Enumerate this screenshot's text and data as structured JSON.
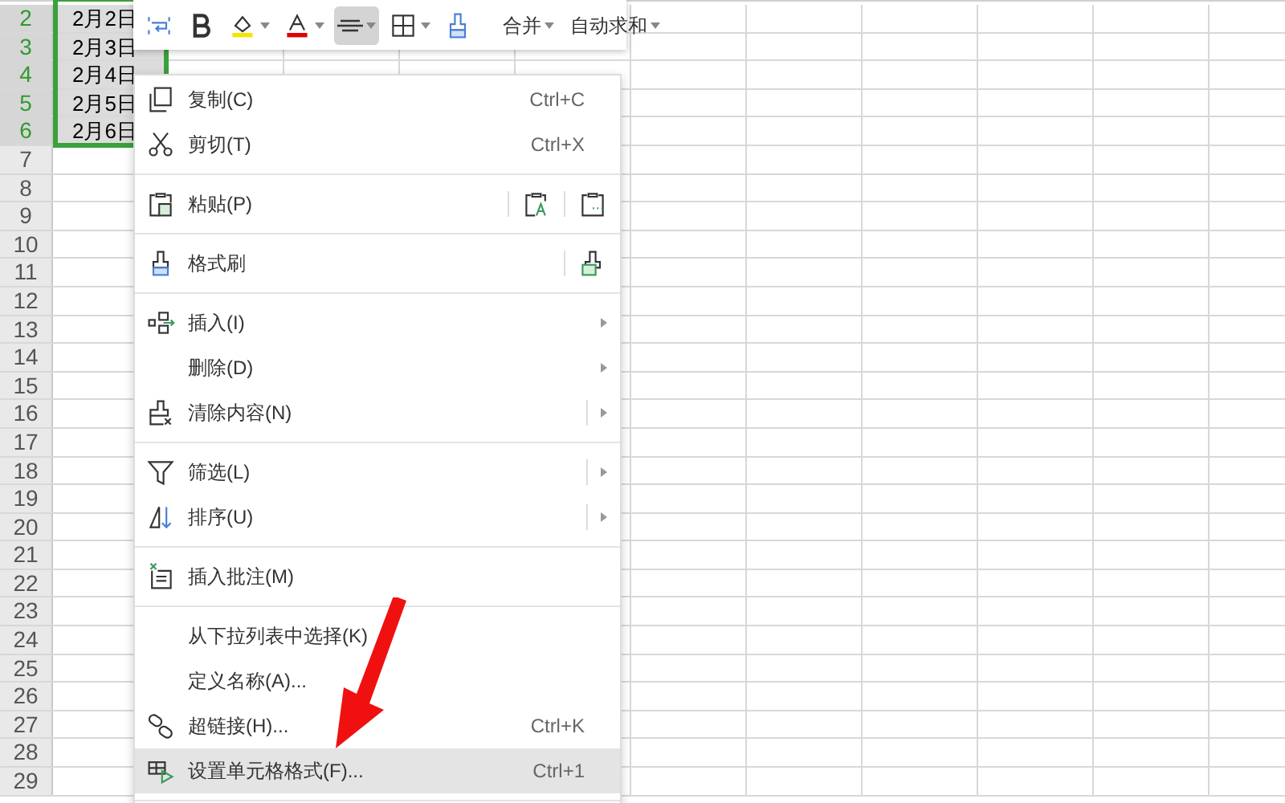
{
  "sheet": {
    "rows": [
      {
        "number": "2",
        "selected": true,
        "cell": "2月2日"
      },
      {
        "number": "3",
        "selected": true,
        "cell": "2月3日"
      },
      {
        "number": "4",
        "selected": true,
        "cell": "2月4日"
      },
      {
        "number": "5",
        "selected": true,
        "cell": "2月5日"
      },
      {
        "number": "6",
        "selected": true,
        "cell": "2月6日"
      },
      {
        "number": "7",
        "selected": false
      },
      {
        "number": "8",
        "selected": false
      },
      {
        "number": "9",
        "selected": false
      },
      {
        "number": "10",
        "selected": false
      },
      {
        "number": "11",
        "selected": false
      },
      {
        "number": "12",
        "selected": false
      },
      {
        "number": "13",
        "selected": false
      },
      {
        "number": "14",
        "selected": false
      },
      {
        "number": "15",
        "selected": false
      },
      {
        "number": "16",
        "selected": false
      },
      {
        "number": "17",
        "selected": false
      },
      {
        "number": "18",
        "selected": false
      },
      {
        "number": "19",
        "selected": false
      },
      {
        "number": "20",
        "selected": false
      },
      {
        "number": "21",
        "selected": false
      },
      {
        "number": "22",
        "selected": false
      },
      {
        "number": "23",
        "selected": false
      },
      {
        "number": "24",
        "selected": false
      },
      {
        "number": "25",
        "selected": false
      },
      {
        "number": "26",
        "selected": false
      },
      {
        "number": "27",
        "selected": false
      },
      {
        "number": "28",
        "selected": false
      },
      {
        "number": "29",
        "selected": false
      }
    ]
  },
  "mini_toolbar": {
    "tools": [
      {
        "kind": "wrap",
        "selected": false,
        "has_caret": false
      },
      {
        "kind": "bold",
        "selected": false,
        "has_caret": false
      },
      {
        "kind": "fill_color",
        "selected": false,
        "has_caret": true
      },
      {
        "kind": "font_color",
        "selected": false,
        "has_caret": true
      },
      {
        "kind": "align",
        "selected": true,
        "has_caret": true
      },
      {
        "kind": "borders",
        "selected": false,
        "has_caret": true
      },
      {
        "kind": "painter",
        "selected": false,
        "has_caret": false
      },
      {
        "kind": "separator"
      },
      {
        "kind": "text",
        "label": "合并",
        "has_caret": true
      },
      {
        "kind": "text",
        "label": "自动求和",
        "has_caret": true
      }
    ]
  },
  "context_menu": {
    "items": [
      {
        "kind": "item",
        "label": "复制(C)",
        "shortcut": "Ctrl+C",
        "has_submenu": false,
        "split": false,
        "highlighted": false
      },
      {
        "kind": "item",
        "label": "剪切(T)",
        "shortcut": "Ctrl+X",
        "has_submenu": false,
        "split": false,
        "highlighted": false
      },
      {
        "kind": "separator"
      },
      {
        "kind": "item",
        "label": "粘贴(P)",
        "has_submenu": false,
        "split": false,
        "highlighted": false
      },
      {
        "kind": "separator"
      },
      {
        "kind": "item",
        "label": "格式刷",
        "has_submenu": false,
        "split": false,
        "highlighted": false
      },
      {
        "kind": "separator"
      },
      {
        "kind": "item",
        "label": "插入(I)",
        "has_submenu": true,
        "split": false,
        "highlighted": false
      },
      {
        "kind": "item",
        "label": "删除(D)",
        "has_submenu": true,
        "split": false,
        "highlighted": false
      },
      {
        "kind": "item",
        "label": "清除内容(N)",
        "has_submenu": true,
        "split": true,
        "highlighted": false
      },
      {
        "kind": "separator"
      },
      {
        "kind": "item",
        "label": "筛选(L)",
        "has_submenu": true,
        "split": true,
        "highlighted": false
      },
      {
        "kind": "item",
        "label": "排序(U)",
        "has_submenu": true,
        "split": true,
        "highlighted": false
      },
      {
        "kind": "separator"
      },
      {
        "kind": "item",
        "label": "插入批注(M)",
        "has_submenu": false,
        "split": false,
        "highlighted": false
      },
      {
        "kind": "separator"
      },
      {
        "kind": "item",
        "label": "从下拉列表中选择(K)",
        "has_submenu": false,
        "split": false,
        "highlighted": false
      },
      {
        "kind": "item",
        "label": "定义名称(A)...",
        "has_submenu": false,
        "split": false,
        "highlighted": false
      },
      {
        "kind": "item",
        "label": "超链接(H)...",
        "shortcut": "Ctrl+K",
        "has_submenu": false,
        "split": false,
        "highlighted": false
      },
      {
        "kind": "item",
        "label": "设置单元格格式(F)...",
        "shortcut": "Ctrl+1",
        "has_submenu": false,
        "split": false,
        "highlighted": true
      },
      {
        "kind": "separator"
      }
    ]
  }
}
